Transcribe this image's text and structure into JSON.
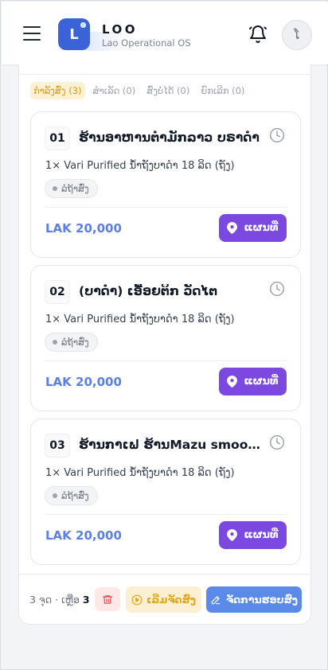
{
  "header": {
    "logo_letter": "L",
    "title": "LOO",
    "subtitle": "Lao Operational OS",
    "avatar_letter": "ໂ"
  },
  "tabs": [
    {
      "label": "ກໍາລັງສົ່ງ (3)",
      "active": true
    },
    {
      "label": "ສໍາເລັດ (0)",
      "active": false
    },
    {
      "label": "ສົ່ງບໍ່ໄດ້ (0)",
      "active": false
    },
    {
      "label": "ຍົກເລີກ (0)",
      "active": false
    }
  ],
  "orders": [
    {
      "number": "01",
      "customer": "ຮ້ານອາຫານຕໍາມັກລາວ ບຣາດໍາ",
      "item": "1× Vari Purified ນ້ໍາຖັງບາດໍາ 18 ລິດ (ຖັງ)",
      "status": "ລໍຖ້າສົ່ງ",
      "price": "LAK 20,000",
      "map_label": "ແຜນທີ່"
    },
    {
      "number": "02",
      "customer": "(ບາດໍາ) ເອື້ອຍຕິກ ວັດໄຕ",
      "item": "1× Vari Purified ນ້ໍາຖັງບາດໍາ 18 ລິດ (ຖັງ)",
      "status": "ລໍຖ້າສົ່ງ",
      "price": "LAK 20,000",
      "map_label": "ແຜນທີ່"
    },
    {
      "number": "03",
      "customer": "ຮ້ານກາເຟ ຮ້ານMazu smoothie ...",
      "item": "1× Vari Purified ນ້ໍາຖັງບາດໍາ 18 ລິດ (ຖັງ)",
      "status": "ລໍຖ້າສົ່ງ",
      "price": "LAK 20,000",
      "map_label": "ແຜນທີ່"
    }
  ],
  "footer": {
    "count_prefix": "3 ຈຸດ · ເຫຼືອ",
    "count_value": "3",
    "start_label": "ເລີ່ມຈັດສົ່ງ",
    "manage_label": "ຈັດການຮອບສົ່ງ"
  },
  "colors": {
    "accent": "#3b63d8",
    "map_button": "#7c49e0",
    "price": "#5b7fe6",
    "active_tab": "#d99a1a"
  }
}
